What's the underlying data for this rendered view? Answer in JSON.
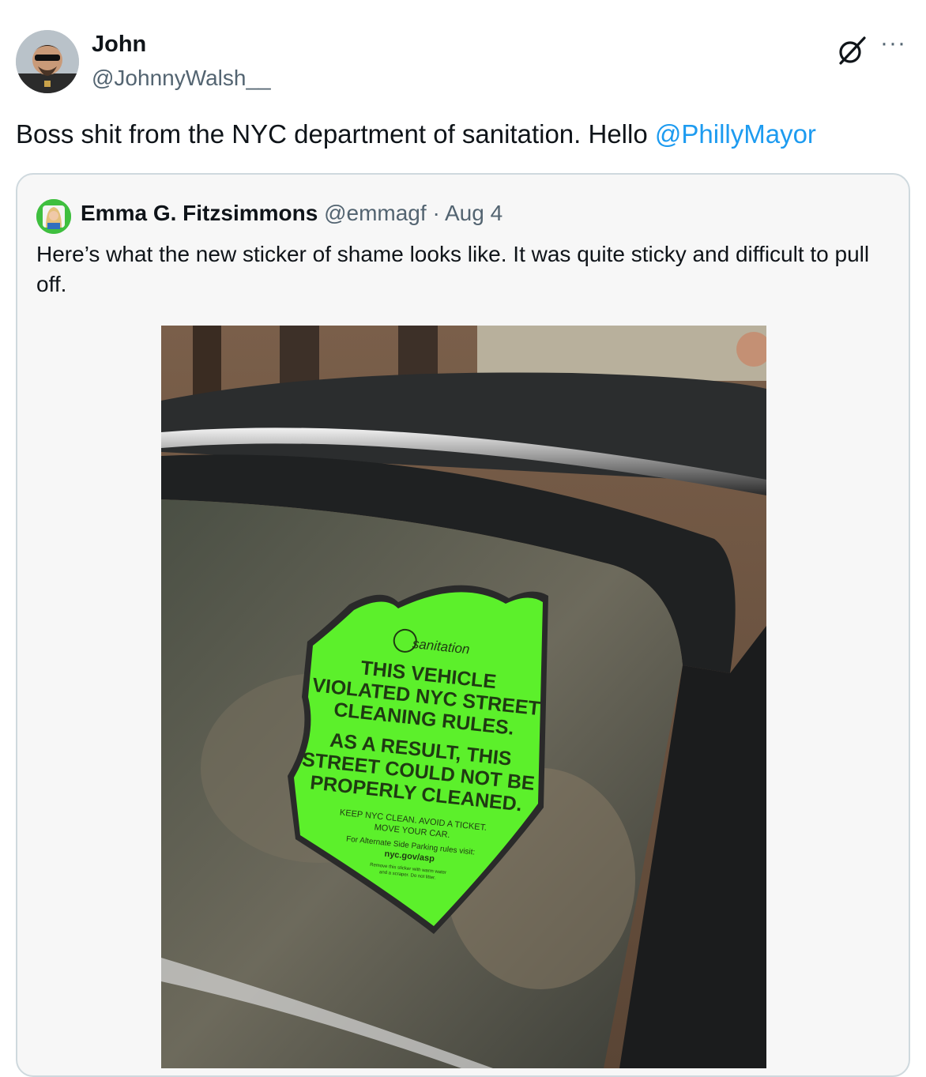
{
  "tweet": {
    "author_name": "John",
    "author_handle": "@JohnnyWalsh__",
    "text_prefix": "Boss shit from the NYC department of sanitation. Hello ",
    "mention": "@PhillyMayor",
    "more_label": "···"
  },
  "quoted": {
    "author_name": "Emma G. Fitzsimmons",
    "author_handle": "@emmagf",
    "separator": "·",
    "date": "Aug 4",
    "text": "Here’s what the new sticker of shame looks like. It was quite sticky and difficult to pull off.",
    "sticker": {
      "brand": "sanitation",
      "line1": "THIS VEHICLE",
      "line2": "VIOLATED NYC STREET",
      "line3": "CLEANING RULES.",
      "line4": "AS A RESULT, THIS",
      "line5": "STREET COULD NOT BE",
      "line6": "PROPERLY CLEANED.",
      "small1": "KEEP NYC CLEAN. AVOID A TICKET.",
      "small2": "MOVE YOUR CAR.",
      "small3": "For Alternate Side Parking rules visit:",
      "url": "nyc.gov/asp",
      "fine1": "Remove this sticker with warm water",
      "fine2": "and a scraper. Do not litter."
    }
  },
  "colors": {
    "mention": "#1d9bf0",
    "sticker": "#5cf02b",
    "border": "#cfd9de"
  },
  "icons": {
    "grok": "grok-icon",
    "more": "more-icon"
  }
}
